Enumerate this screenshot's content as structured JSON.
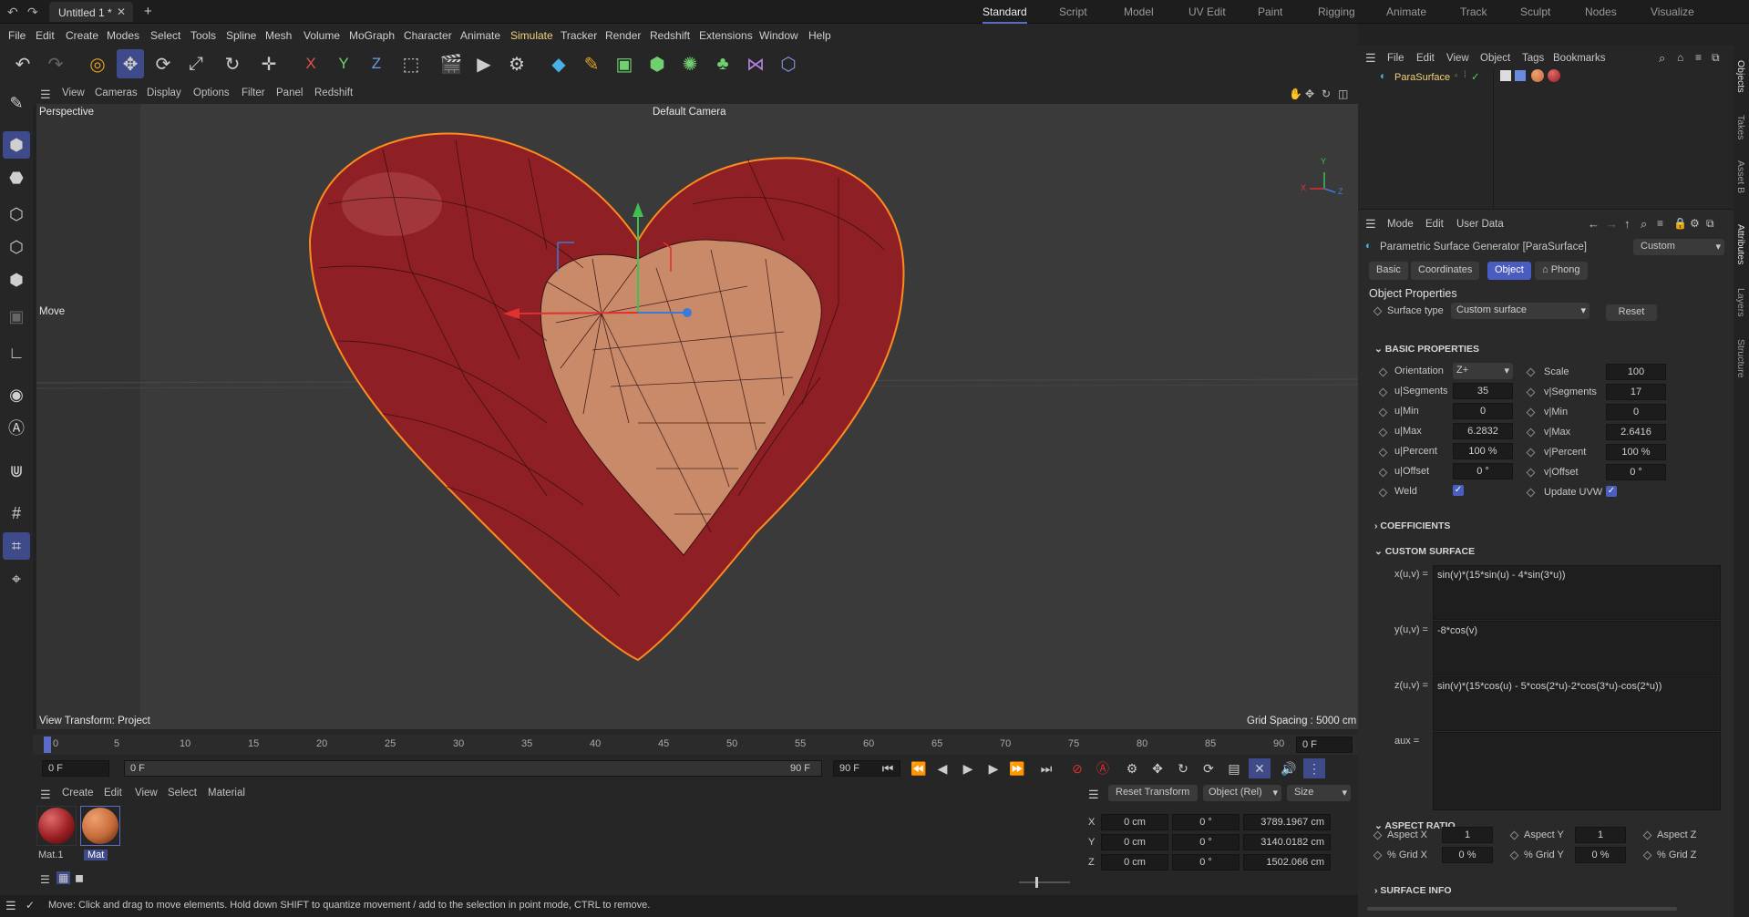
{
  "titlebar": {
    "doc_tab": "Untitled 1 *",
    "layouts": [
      "Standard",
      "Script",
      "Model",
      "UV Edit",
      "Paint",
      "Rigging",
      "Animate",
      "Track",
      "Sculpt",
      "Nodes",
      "Visualize"
    ],
    "active_layout": "Standard"
  },
  "menubar": [
    "File",
    "Edit",
    "Create",
    "Modes",
    "Select",
    "Tools",
    "Spline",
    "Mesh",
    "Volume",
    "MoGraph",
    "Character",
    "Animate",
    "Simulate",
    "Tracker",
    "Render",
    "Redshift",
    "Extensions",
    "Window",
    "Help"
  ],
  "toolbar": {
    "axes": [
      "X",
      "Y",
      "Z"
    ]
  },
  "viewport": {
    "menu": [
      "View",
      "Cameras",
      "Display",
      "Options",
      "Filter",
      "Panel",
      "Redshift"
    ],
    "label": "Perspective",
    "camera": "Default Camera",
    "tool": "Move",
    "view_transform": "View Transform: Project",
    "grid_spacing": "Grid Spacing : 5000 cm",
    "axis_labels": {
      "x": "X",
      "y": "Y",
      "z": "Z"
    },
    "colors": {
      "surface": "#8e1f24",
      "inside": "#c98a6a",
      "outline": "#ff8a1e"
    }
  },
  "timeline": {
    "ticks": [
      "0",
      "5",
      "10",
      "15",
      "20",
      "25",
      "30",
      "35",
      "40",
      "45",
      "50",
      "55",
      "60",
      "65",
      "70",
      "75",
      "80",
      "85",
      "90"
    ],
    "current_frame": "0 F",
    "start_field": "0 F",
    "range_start": "0 F",
    "range_end": "90 F",
    "end_field": "90 F",
    "frame_readout": "0 F"
  },
  "materials": {
    "menu": [
      "Create",
      "Edit",
      "View",
      "Select",
      "Material"
    ],
    "items": [
      {
        "name": "Mat.1",
        "color": "#9a1e22"
      },
      {
        "name": "Mat",
        "color": "#c46a3a"
      }
    ]
  },
  "coords": {
    "reset": "Reset Transform",
    "mode": "Object (Rel)",
    "size_mode": "Size",
    "rows": [
      {
        "axis": "X",
        "pos": "0 cm",
        "rot": "0 °",
        "size": "3789.1967 cm"
      },
      {
        "axis": "Y",
        "pos": "0 cm",
        "rot": "0 °",
        "size": "3140.0182 cm"
      },
      {
        "axis": "Z",
        "pos": "0 cm",
        "rot": "0 °",
        "size": "1502.066 cm"
      }
    ]
  },
  "status": "Move: Click and drag to move elements. Hold down SHIFT to quantize movement / add to the selection in point mode, CTRL to remove.",
  "object_manager": {
    "menu": [
      "File",
      "Edit",
      "View",
      "Object",
      "Tags",
      "Bookmarks"
    ],
    "object_name": "ParaSurface"
  },
  "attributes": {
    "menu": [
      "Mode",
      "Edit",
      "User Data"
    ],
    "title": "Parametric Surface Generator [ParaSurface]",
    "preset": "Custom",
    "tabs": [
      "Basic",
      "Coordinates",
      "Object",
      "Phong"
    ],
    "active_tab": "Object",
    "section_title": "Object Properties",
    "surface_type_label": "Surface type",
    "surface_type_value": "Custom surface",
    "reset_label": "Reset",
    "basic_header": "BASIC PROPERTIES",
    "left_props": [
      {
        "label": "Orientation",
        "value": "Z+"
      },
      {
        "label": "u|Segments",
        "value": "35"
      },
      {
        "label": "u|Min",
        "value": "0"
      },
      {
        "label": "u|Max",
        "value": "6.2832"
      },
      {
        "label": "u|Percent",
        "value": "100 %"
      },
      {
        "label": "u|Offset",
        "value": "0 °"
      },
      {
        "label": "Weld",
        "value": "✓"
      }
    ],
    "right_props": [
      {
        "label": "Scale",
        "value": "100"
      },
      {
        "label": "v|Segments",
        "value": "17"
      },
      {
        "label": "v|Min",
        "value": "0"
      },
      {
        "label": "v|Max",
        "value": "2.6416"
      },
      {
        "label": "v|Percent",
        "value": "100 %"
      },
      {
        "label": "v|Offset",
        "value": "0 °"
      },
      {
        "label": "Update UVW",
        "value": "✓"
      }
    ],
    "coefficients_header": "COEFFICIENTS",
    "custom_header": "CUSTOM SURFACE",
    "formulas": [
      {
        "label": "x(u,v) =",
        "value": "sin(v)*(15*sin(u) - 4*sin(3*u))"
      },
      {
        "label": "y(u,v) =",
        "value": "-8*cos(v)"
      },
      {
        "label": "z(u,v) =",
        "value": "sin(v)*(15*cos(u) - 5*cos(2*u)-2*cos(3*u)-cos(2*u))"
      },
      {
        "label": "aux =",
        "value": ""
      }
    ],
    "aspect_header": "ASPECT RATIO",
    "aspect": [
      {
        "label": "Aspect X",
        "value": "1"
      },
      {
        "label": "Aspect Y",
        "value": "1"
      },
      {
        "label": "Aspect Z",
        "value": ""
      }
    ],
    "grid": [
      {
        "label": "% Grid X",
        "value": "0 %"
      },
      {
        "label": "% Grid Y",
        "value": "0 %"
      },
      {
        "label": "% Grid Z",
        "value": ""
      }
    ],
    "surface_info_header": "SURFACE INFO"
  },
  "side_tabs": [
    "Objects",
    "Takes",
    "Asset B",
    "Attributes",
    "Layers",
    "Structure"
  ]
}
